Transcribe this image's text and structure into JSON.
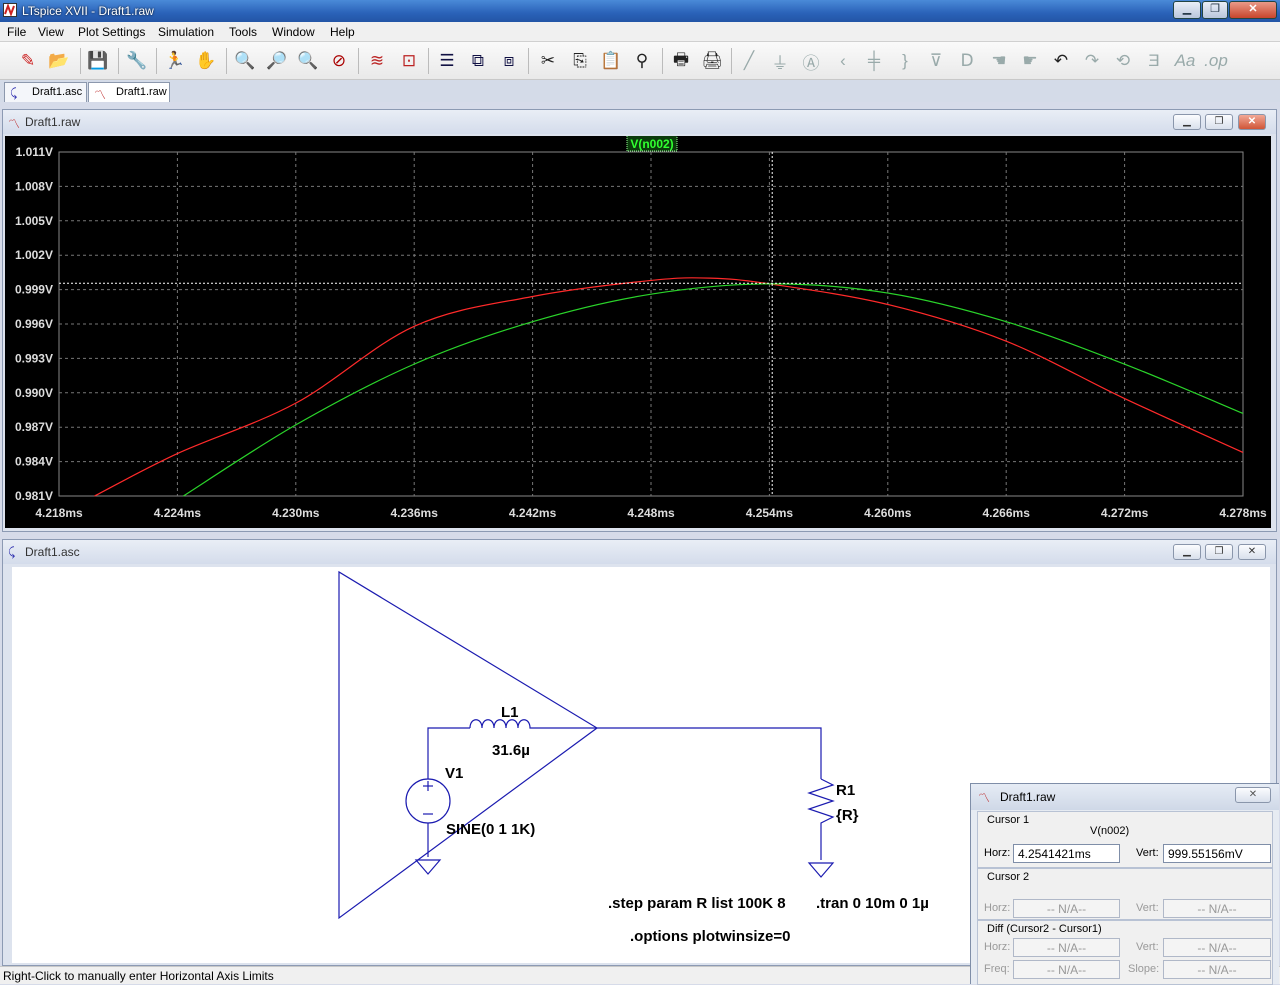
{
  "window": {
    "title": "LTspice XVII - Draft1.raw"
  },
  "menu": [
    "File",
    "View",
    "Plot Settings",
    "Simulation",
    "Tools",
    "Window",
    "Help"
  ],
  "tabs": [
    {
      "label": "Draft1.asc",
      "active": false
    },
    {
      "label": "Draft1.raw",
      "active": true
    }
  ],
  "plot_window": {
    "title": "Draft1.raw"
  },
  "chart_data": {
    "type": "line",
    "trace_label": "V(n002)",
    "xlabel": "",
    "ylabel": "",
    "x_ticks": [
      "4.218ms",
      "4.224ms",
      "4.230ms",
      "4.236ms",
      "4.242ms",
      "4.248ms",
      "4.254ms",
      "4.260ms",
      "4.266ms",
      "4.272ms",
      "4.278ms"
    ],
    "y_ticks": [
      "1.011V",
      "1.008V",
      "1.005V",
      "1.002V",
      "0.999V",
      "0.996V",
      "0.993V",
      "0.990V",
      "0.987V",
      "0.984V",
      "0.981V"
    ],
    "xlim": [
      4.218,
      4.278
    ],
    "ylim": [
      0.981,
      1.011
    ],
    "grid": true,
    "cursor": {
      "x": 4.2541421,
      "y": 0.99955156
    },
    "series": [
      {
        "color": "#ff2a2a",
        "x": [
          4.2198,
          4.224,
          4.23,
          4.236,
          4.242,
          4.248,
          4.251,
          4.254,
          4.26,
          4.266,
          4.272,
          4.278
        ],
        "y": [
          0.981,
          0.9847,
          0.9891,
          0.9958,
          0.9984,
          0.9998,
          1.0,
          0.9995,
          0.9977,
          0.9945,
          0.9895,
          0.9848
        ]
      },
      {
        "color": "#2ad32a",
        "x": [
          4.2243,
          4.23,
          4.236,
          4.242,
          4.248,
          4.254,
          4.26,
          4.266,
          4.272,
          4.278
        ],
        "y": [
          0.981,
          0.9872,
          0.9925,
          0.9962,
          0.9986,
          0.9995,
          0.9987,
          0.9962,
          0.9925,
          0.9882
        ]
      }
    ]
  },
  "schematic_window": {
    "title": "Draft1.asc"
  },
  "schematic": {
    "l1_name": "L1",
    "l1_value": "31.6µ",
    "v1_name": "V1",
    "v1_value": "SINE(0 1 1K)",
    "r1_name": "R1",
    "r1_value": "{R}",
    "directive_step": ".step param R list 100K 8",
    "directive_tran": ".tran 0 10m 0 1µ",
    "directive_options": ".options plotwinsize=0"
  },
  "cursor_window": {
    "title": "Draft1.raw",
    "cursor1_label": "Cursor 1",
    "trace": "V(n002)",
    "horz_label": "Horz:",
    "horz_value": "4.2541421ms",
    "vert_label": "Vert:",
    "vert_value": "999.55156mV",
    "cursor2_label": "Cursor 2",
    "c2_horz": "-- N/A--",
    "c2_vert": "-- N/A--",
    "diff_label": "Diff (Cursor2 - Cursor1)",
    "diff_horz": "-- N/A--",
    "diff_vert": "-- N/A--",
    "freq_label": "Freq:",
    "freq_value": "-- N/A--",
    "slope_label": "Slope:",
    "slope_value": "-- N/A--"
  },
  "status": {
    "text": "Right-Click to manually enter Horizontal Axis Limits"
  }
}
